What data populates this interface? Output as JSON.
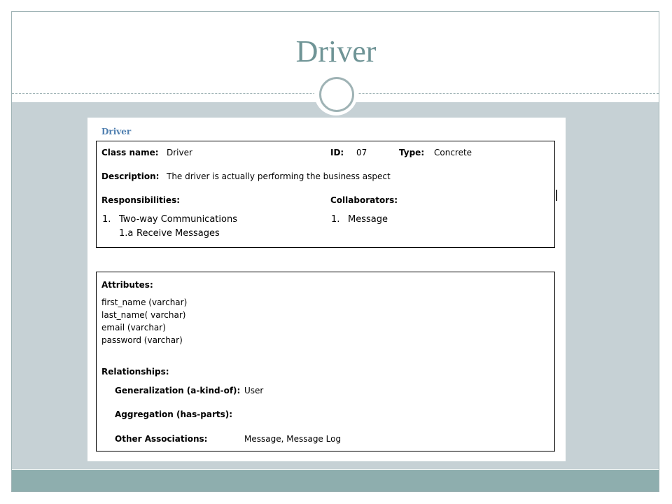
{
  "slide": {
    "title": "Driver"
  },
  "document": {
    "heading": "Driver",
    "class_box": {
      "class_name_label": "Class name:",
      "class_name_value": "Driver",
      "id_label": "ID:",
      "id_value": "07",
      "type_label": "Type:",
      "type_value": "Concrete",
      "description_label": "Description:",
      "description_value": "The driver is actually performing the business aspect",
      "responsibilities_label": "Responsibilities:",
      "responsibilities": [
        {
          "num": "1.",
          "text": "Two-way Communications"
        },
        {
          "num": "1.a",
          "text": "Receive Messages"
        }
      ],
      "collaborators_label": "Collaborators:",
      "collaborators": [
        {
          "num": "1.",
          "text": "Message"
        }
      ]
    },
    "attributes_box": {
      "attributes_label": "Attributes:",
      "attributes": [
        "first_name (varchar)",
        "last_name( varchar)",
        "email (varchar)",
        "password (varchar)"
      ],
      "relationships_label": "Relationships:",
      "generalization_label": "Generalization (a-kind-of):",
      "generalization_value": "User",
      "aggregation_label": "Aggregation (has-parts):",
      "aggregation_value": "",
      "other_label": "Other Associations:",
      "other_value": "Message, Message Log"
    }
  },
  "colors": {
    "title": "#6f9496",
    "content_band": "#c6d1d5",
    "footer_band": "#8eaeae",
    "doc_heading": "#4f7fb0"
  }
}
